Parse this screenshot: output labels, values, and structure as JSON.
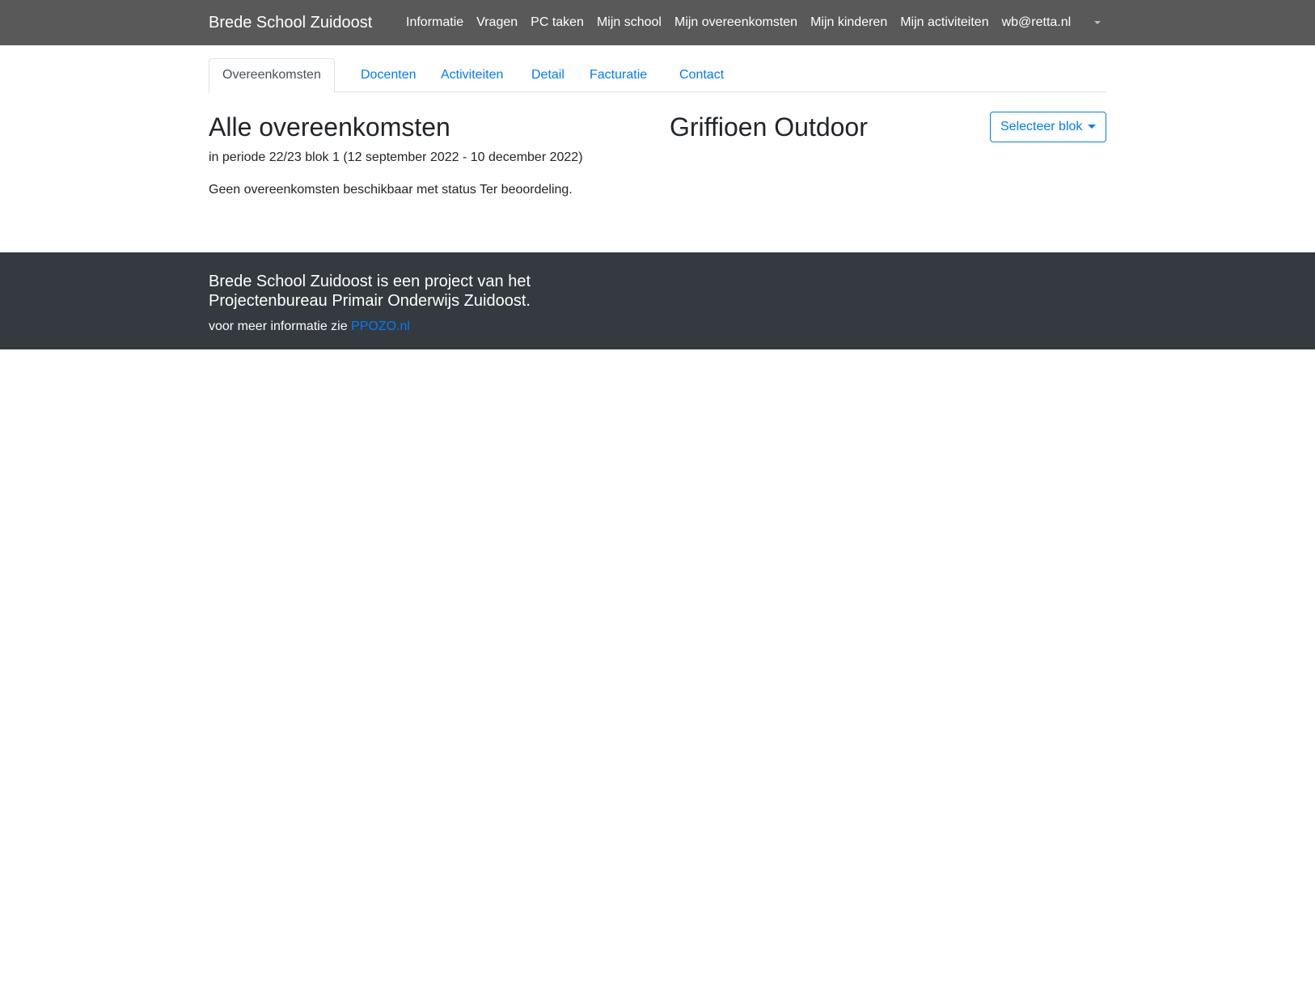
{
  "navbar": {
    "brand": "Brede School Zuidoost",
    "links": [
      "Informatie",
      "Vragen",
      "PC taken",
      "Mijn school",
      "Mijn overeenkomsten",
      "Mijn kinderen",
      "Mijn activiteiten",
      "wb@retta.nl"
    ],
    "dropdown_icon": "caret-down-icon"
  },
  "tabs": {
    "items": [
      "Overeenkomsten",
      "Docenten",
      "Activiteiten",
      "Detail",
      "Facturatie",
      "Contact"
    ],
    "active": "Overeenkomsten"
  },
  "main": {
    "title": "Alle overeenkomsten",
    "period": "in periode 22/23 blok 1 (12 september 2022 - 10 december 2022)",
    "empty_message": "Geen overeenkomsten beschikbaar met status Ter beoordeling.",
    "organization": "Griffioen Outdoor",
    "select_block_label": "Selecteer blok"
  },
  "footer": {
    "line1": "Brede School Zuidoost is een project van het",
    "line2": "Projectenbureau Primair Onderwijs Zuidoost.",
    "more_prefix": "voor meer informatie zie",
    "more_link": "PPOZO.nl"
  },
  "colors": {
    "navbar_bg": "#595959",
    "footer_bg": "#343a40",
    "link": "#007bff",
    "text": "#212529"
  }
}
